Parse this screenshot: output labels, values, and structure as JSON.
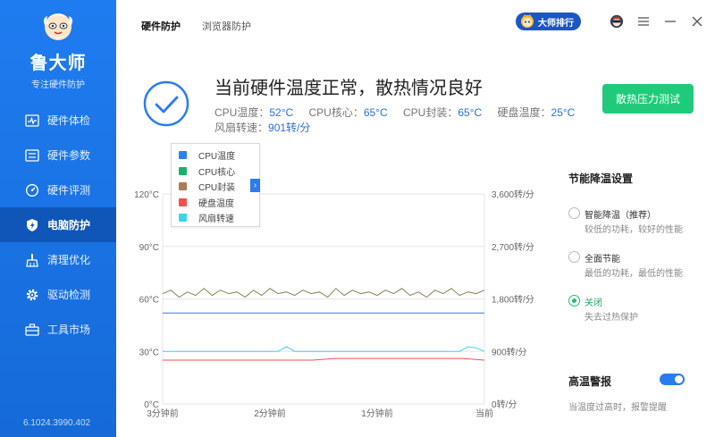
{
  "app": {
    "name": "鲁大师",
    "subtitle": "专注硬件防护",
    "version": "6.1024.3990.402"
  },
  "sidebar": {
    "items": [
      {
        "label": "硬件体检",
        "icon": "pulse-icon",
        "active": false
      },
      {
        "label": "硬件参数",
        "icon": "list-icon",
        "active": false
      },
      {
        "label": "硬件评测",
        "icon": "gauge-icon",
        "active": false
      },
      {
        "label": "电脑防护",
        "icon": "shield-bolt-icon",
        "active": true
      },
      {
        "label": "清理优化",
        "icon": "broom-icon",
        "active": false
      },
      {
        "label": "驱动检测",
        "icon": "gear-icon",
        "active": false
      },
      {
        "label": "工具市场",
        "icon": "toolbox-icon",
        "active": false
      }
    ]
  },
  "tabs": [
    {
      "label": "硬件防护",
      "active": true
    },
    {
      "label": "浏览器防护",
      "active": false
    }
  ],
  "topbar": {
    "rank_label": "大师排行"
  },
  "status": {
    "headline": "当前硬件温度正常，散热情况良好",
    "cpu_temp_label": "CPU温度：",
    "cpu_temp": "52°C",
    "cpu_core_label": "CPU核心：",
    "cpu_core": "65°C",
    "cpu_pkg_label": "CPU封装：",
    "cpu_pkg": "65°C",
    "disk_label": "硬盘温度：",
    "disk": "25°C",
    "fan_label": "风扇转速：",
    "fan": "901转/分",
    "stress_button": "散热压力测试"
  },
  "legend": [
    {
      "label": "CPU温度",
      "color": "#2f7ff0"
    },
    {
      "label": "CPU核心",
      "color": "#18b26b"
    },
    {
      "label": "CPU封装",
      "color": "#b07a56"
    },
    {
      "label": "硬盘温度",
      "color": "#f25050"
    },
    {
      "label": "风扇转速",
      "color": "#3fd2ef"
    }
  ],
  "chart_data": {
    "type": "line",
    "y_left_ticks": [
      "0°C",
      "30°C",
      "60°C",
      "90°C",
      "120°C"
    ],
    "y_right_ticks": [
      "0转/分",
      "900转/分",
      "1,800转/分",
      "2,700转/分",
      "3,600转/分"
    ],
    "x_ticks": [
      "3分钟前",
      "2分钟前",
      "1分钟前",
      "当前"
    ],
    "ylim_left": [
      0,
      120
    ],
    "ylim_right": [
      0,
      3600
    ],
    "series": [
      {
        "name": "CPU温度",
        "color": "#2f7ff0",
        "axis": "left",
        "values": [
          52,
          52,
          52,
          52,
          52,
          52,
          52,
          52,
          52,
          52
        ]
      },
      {
        "name": "CPU封装",
        "color": "#8a8055",
        "axis": "left",
        "values": [
          63,
          65,
          61,
          64,
          62,
          66,
          62,
          65,
          63,
          64,
          61,
          65,
          62,
          66,
          63,
          64,
          62,
          65,
          63,
          64,
          61,
          66,
          62,
          65,
          63,
          64,
          62,
          65,
          63,
          66,
          62,
          64,
          61,
          65,
          63,
          66,
          62,
          64,
          63,
          65
        ]
      },
      {
        "name": "风扇转速",
        "color": "#3fd2ef",
        "axis": "right",
        "values": [
          901,
          901,
          901,
          901,
          901,
          901,
          901,
          901,
          901,
          901,
          901,
          901,
          901,
          901,
          901,
          980,
          901,
          901,
          901,
          901,
          901,
          901,
          901,
          901,
          901,
          901,
          901,
          901,
          901,
          901,
          901,
          901,
          901,
          901,
          901,
          901,
          901,
          980,
          960,
          901
        ]
      },
      {
        "name": "硬盘温度",
        "color": "#f25050",
        "axis": "left",
        "values": [
          25,
          25,
          25,
          25,
          25,
          25,
          25,
          25,
          26,
          26,
          26,
          26,
          26,
          26,
          26,
          25
        ]
      }
    ],
    "grid": true
  },
  "panel": {
    "title": "节能降温设置",
    "options": [
      {
        "label": "智能降温（推荐）",
        "desc": "较低的功耗，较好的性能",
        "selected": false
      },
      {
        "label": "全面节能",
        "desc": "最低的功耗，最低的性能",
        "selected": false
      },
      {
        "label": "关闭",
        "desc": "失去过热保护",
        "selected": true
      }
    ],
    "alarm_title": "高温警报",
    "alarm_on": true,
    "alarm_desc": "当温度过高时，报警提醒"
  }
}
